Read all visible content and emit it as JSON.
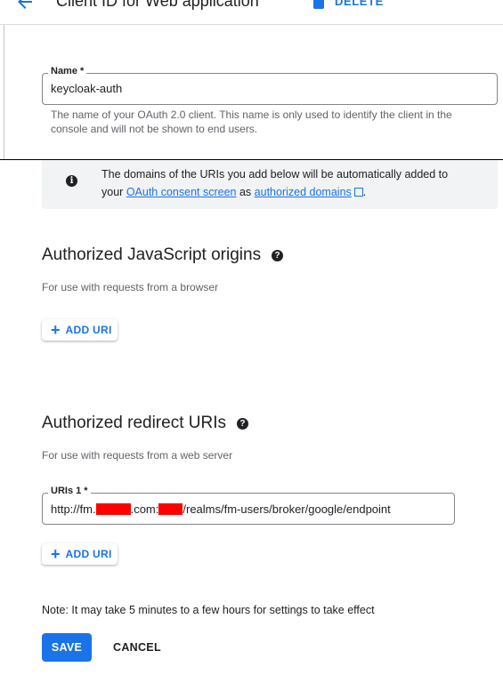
{
  "header": {
    "title": "Client ID for Web application",
    "delete_label": "DELETE"
  },
  "name_field": {
    "label": "Name *",
    "value": "keycloak-auth",
    "hint_line1": "The name of your OAuth 2.0 client. This name is only used to identify the client in the",
    "hint_line2": "console and will not be shown to end users."
  },
  "info_banner": {
    "line1": "The domains of the URIs you add below will be automatically added to",
    "text_your": "your",
    "link_consent": "OAuth consent screen",
    "text_as": "as",
    "link_domains": "authorized domains",
    "text_end": "."
  },
  "js_origins": {
    "title": "Authorized JavaScript origins",
    "subtitle": "For use with requests from a browser",
    "add_label": "ADD URI"
  },
  "redirect_uris": {
    "title": "Authorized redirect URIs",
    "subtitle": "For use with requests from a web server",
    "field_label": "URIs 1 *",
    "value_part1": "http://fm.",
    "value_part2": ".com:",
    "value_part3": "/realms/fm-users/broker/google/endpoint",
    "add_label": "ADD URI"
  },
  "footer": {
    "note": "Note: It may take 5 minutes to a few hours for settings to take effect",
    "save_label": "SAVE",
    "cancel_label": "CANCEL"
  },
  "colors": {
    "accent": "#1a73e8",
    "redaction": "#ff0000",
    "banner_bg": "#f1f3f4"
  }
}
